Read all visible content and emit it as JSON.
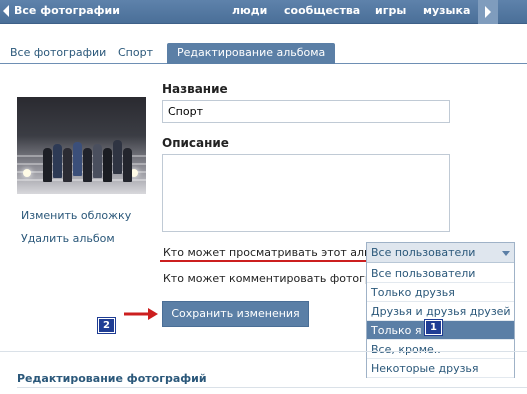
{
  "topbar": {
    "title": "Все фотографии",
    "nav": [
      "люди",
      "сообщества",
      "игры",
      "музыка"
    ]
  },
  "tabs": [
    "Все фотографии",
    "Спорт",
    "Редактирование альбома"
  ],
  "active_tab": "Редактирование альбома",
  "left": {
    "change_cover": "Изменить обложку",
    "delete_album": "Удалить альбом"
  },
  "form": {
    "name_label": "Название",
    "name_value": "Спорт",
    "description_label": "Описание",
    "description_value": "",
    "view_label": "Кто может просматривать этот альбом?",
    "comment_label": "Кто может комментировать фотографии?",
    "save_label": "Сохранить изменения"
  },
  "dropdown": {
    "selected": "Все пользователи",
    "options": [
      "Все пользователи",
      "Только друзья",
      "Друзья и друзья друзей",
      "Только я",
      "Все, кроме..",
      "Некоторые друзья"
    ],
    "highlighted": "Только я"
  },
  "badges": [
    "1",
    "2"
  ],
  "footer": {
    "title": "Редактирование фотографий"
  },
  "colors": {
    "topbar": "#5e82ab",
    "accent": "#5b7fa6",
    "link": "#2b587a",
    "annotation_badge": "#1f3d94",
    "annotation_arrow": "#cc1f1f"
  }
}
